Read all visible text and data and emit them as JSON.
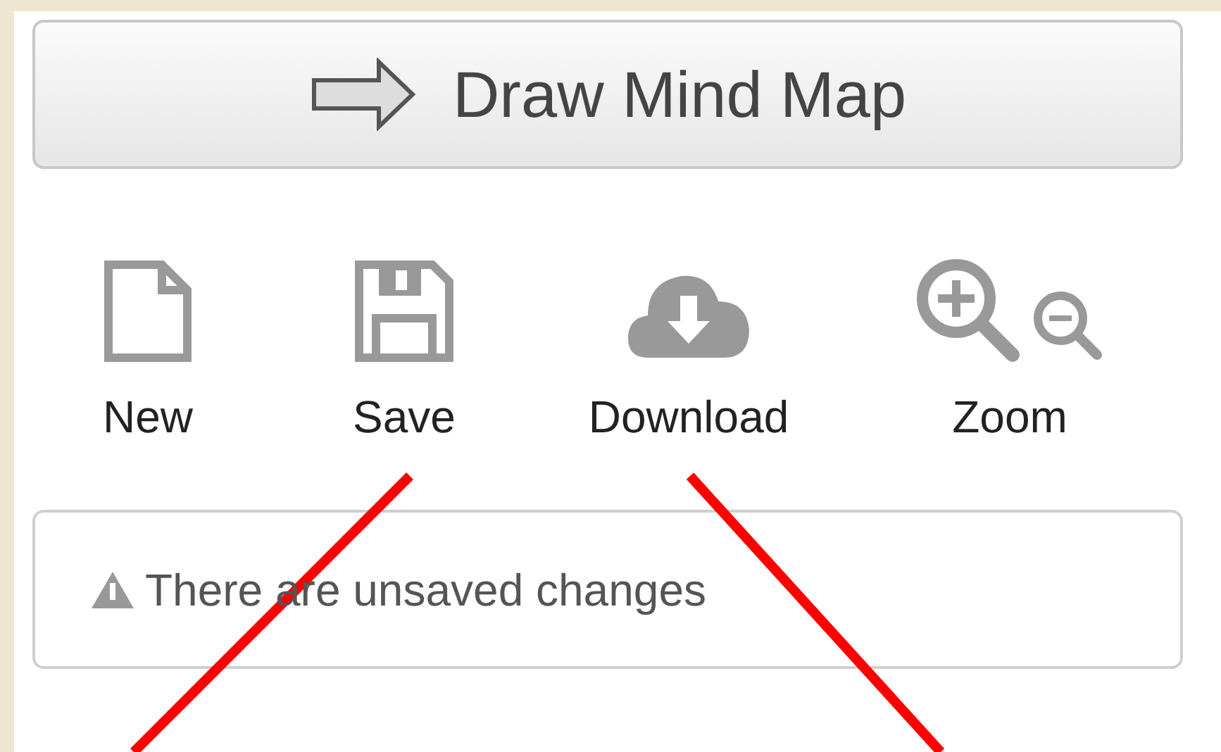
{
  "draw_button": {
    "label": "Draw Mind Map"
  },
  "toolbar": [
    {
      "kind": "new",
      "label": "New"
    },
    {
      "kind": "save",
      "label": "Save"
    },
    {
      "kind": "download",
      "label": "Download"
    },
    {
      "kind": "zoom",
      "label": "Zoom"
    }
  ],
  "status": {
    "message": "There are unsaved changes"
  }
}
